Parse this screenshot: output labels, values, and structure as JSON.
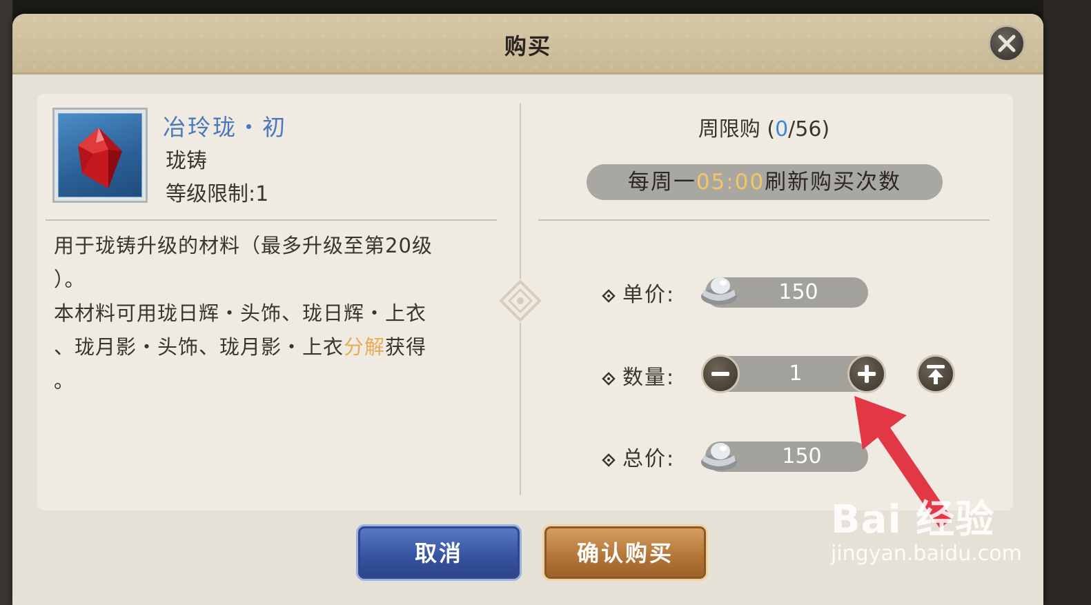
{
  "dialog": {
    "title": "购买"
  },
  "item": {
    "name": "冶玲珑・初",
    "category": "珑铸",
    "level_label": "等级限制:1"
  },
  "description": {
    "line1": "用于珑铸升级的材料（最多升级至第20级",
    "line2": "）。",
    "line3": "本材料可用珑日辉・头饰、珑日辉・上衣",
    "line4_a": "、珑月影・头饰、珑月影・上衣",
    "line4_hl": "分解",
    "line4_b": "获得",
    "line5": "。"
  },
  "limit": {
    "prefix": "周限购",
    "open": "(",
    "used": "0",
    "sep": "/",
    "max": "56",
    "close": ")"
  },
  "refresh": {
    "prefix": "每周一",
    "time": "05:00",
    "suffix": "刷新购买次数"
  },
  "unit_price": {
    "label": "单价:",
    "value": "150"
  },
  "quantity": {
    "label": "数量:",
    "value": "1"
  },
  "total_price": {
    "label": "总价:",
    "value": "150"
  },
  "buttons": {
    "cancel": "取消",
    "confirm": "确认购买"
  },
  "watermark": {
    "main": "Bai 经验",
    "sub": "jingyan.baidu.com"
  },
  "colors": {
    "item_name": "#4b78ba",
    "highlight_gold": "#e6ad58",
    "limit_used": "#3f86d6",
    "cancel_button": "#36529e",
    "confirm_button": "#b27436",
    "annotation_arrow": "#e23845"
  },
  "icons": [
    "close-icon",
    "gem-icon",
    "silver-ingot-icon",
    "minus-icon",
    "plus-icon",
    "max-icon",
    "diamond-bullet-icon"
  ]
}
